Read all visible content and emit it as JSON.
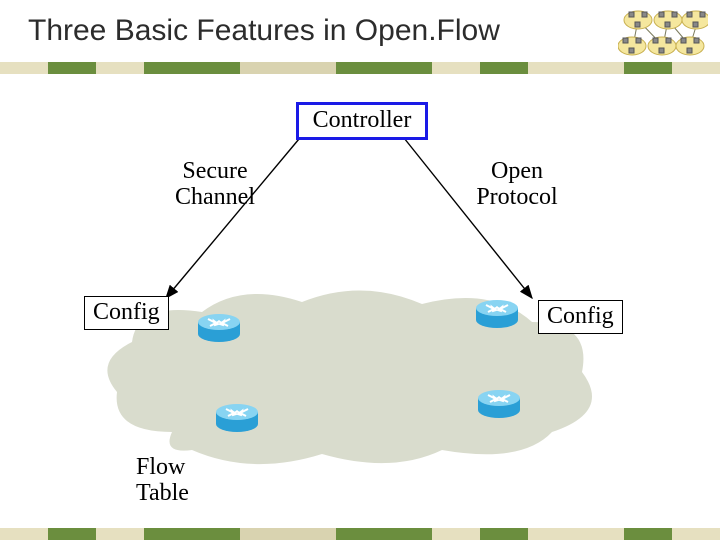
{
  "title": "Three Basic Features in Open.Flow",
  "labels": {
    "controller": "Controller",
    "secure_channel": "Secure\nChannel",
    "open_protocol": "Open\nProtocol",
    "config_left": "Config",
    "config_right": "Config",
    "flow_table": "Flow\nTable"
  },
  "colors": {
    "stripe_segments": [
      "#E6E0C0",
      "#6B8E3E",
      "#E6E0C0",
      "#6B8E3E",
      "#6B8E3E",
      "#D9D3B0",
      "#D9D3B0",
      "#6B8E3E",
      "#6B8E3E",
      "#E6E0C0",
      "#6B8E3E",
      "#E6E0C0",
      "#E6E0C0",
      "#6B8E3E",
      "#E6E0C0"
    ],
    "controller_border": "#1a1ae6",
    "router_body": "#2a9fd6",
    "router_top": "#88d4f2",
    "cloud_fill": "#d9dccd",
    "decor_node": "#f5e79e",
    "decor_box": "#666666"
  },
  "decor_icon": {
    "alt": "network-of-nodes-icon"
  }
}
